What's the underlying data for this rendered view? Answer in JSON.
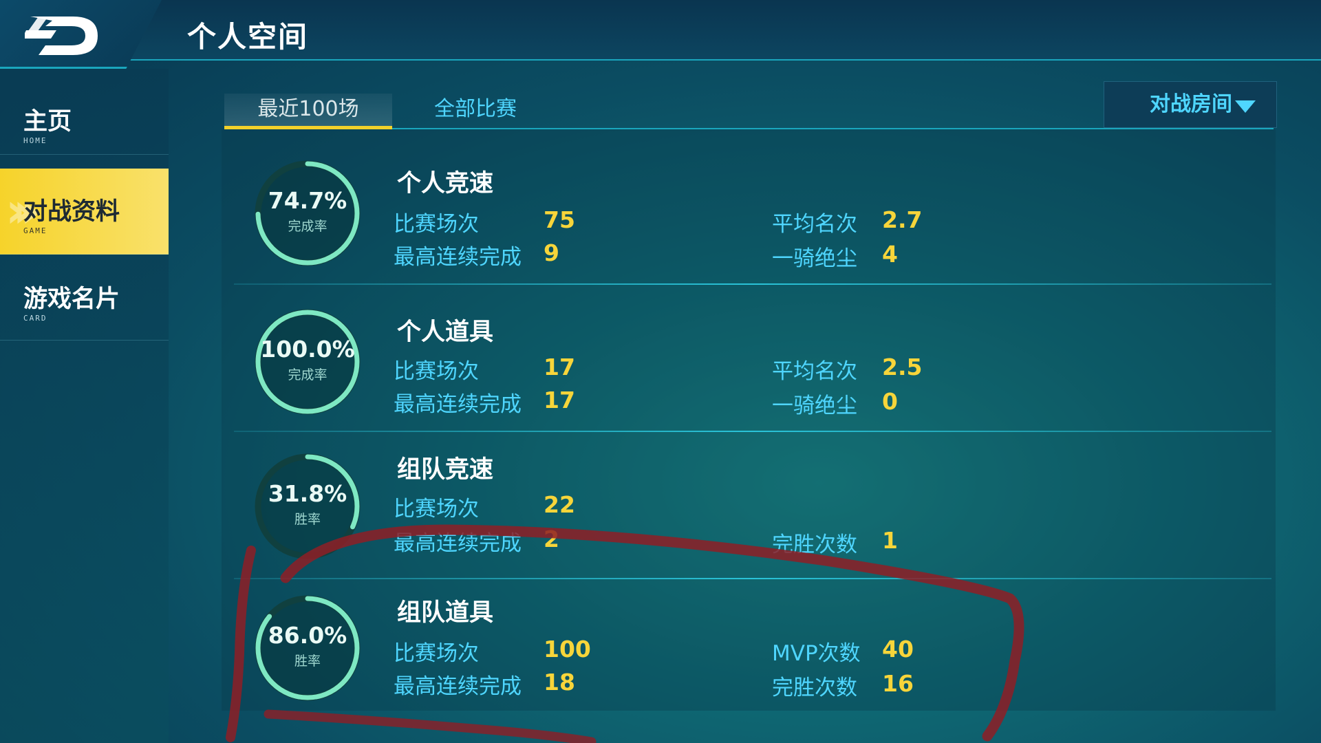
{
  "header": {
    "title": "个人空间"
  },
  "sidebar": {
    "items": [
      {
        "label": "主页",
        "sub": "HOME"
      },
      {
        "label": "对战资料",
        "sub": "GAME"
      },
      {
        "label": "游戏名片",
        "sub": "CARD"
      }
    ]
  },
  "tabs": [
    {
      "label": "最近100场"
    },
    {
      "label": "全部比赛"
    }
  ],
  "room_select": {
    "value": "对战房间"
  },
  "colors": {
    "accent_yellow": "#f6d32a",
    "label_blue": "#4fd6ff",
    "value_yellow": "#f7d53a",
    "ring_green": "#7ee8c3"
  },
  "stats": [
    {
      "title": "个人竞速",
      "rate": "74.7%",
      "rate_fraction": 0.747,
      "rate_label": "完成率",
      "left": [
        {
          "label": "比赛场次",
          "value": "75"
        },
        {
          "label": "最高连续完成",
          "value": "9"
        }
      ],
      "right": [
        {
          "label": "平均名次",
          "value": "2.7"
        },
        {
          "label": "一骑绝尘",
          "value": "4"
        }
      ]
    },
    {
      "title": "个人道具",
      "rate": "100.0%",
      "rate_fraction": 1.0,
      "rate_label": "完成率",
      "left": [
        {
          "label": "比赛场次",
          "value": "17"
        },
        {
          "label": "最高连续完成",
          "value": "17"
        }
      ],
      "right": [
        {
          "label": "平均名次",
          "value": "2.5"
        },
        {
          "label": "一骑绝尘",
          "value": "0"
        }
      ]
    },
    {
      "title": "组队竞速",
      "rate": "31.8%",
      "rate_fraction": 0.318,
      "rate_label": "胜率",
      "left": [
        {
          "label": "比赛场次",
          "value": "22"
        },
        {
          "label": "最高连续完成",
          "value": "2"
        }
      ],
      "right": [
        {
          "label": "完胜次数",
          "value": "1"
        }
      ]
    },
    {
      "title": "组队道具",
      "rate": "86.0%",
      "rate_fraction": 0.86,
      "rate_label": "胜率",
      "left": [
        {
          "label": "比赛场次",
          "value": "100"
        },
        {
          "label": "最高连续完成",
          "value": "18"
        }
      ],
      "right": [
        {
          "label": "MVP次数",
          "value": "40"
        },
        {
          "label": "完胜次数",
          "value": "16"
        }
      ]
    }
  ]
}
